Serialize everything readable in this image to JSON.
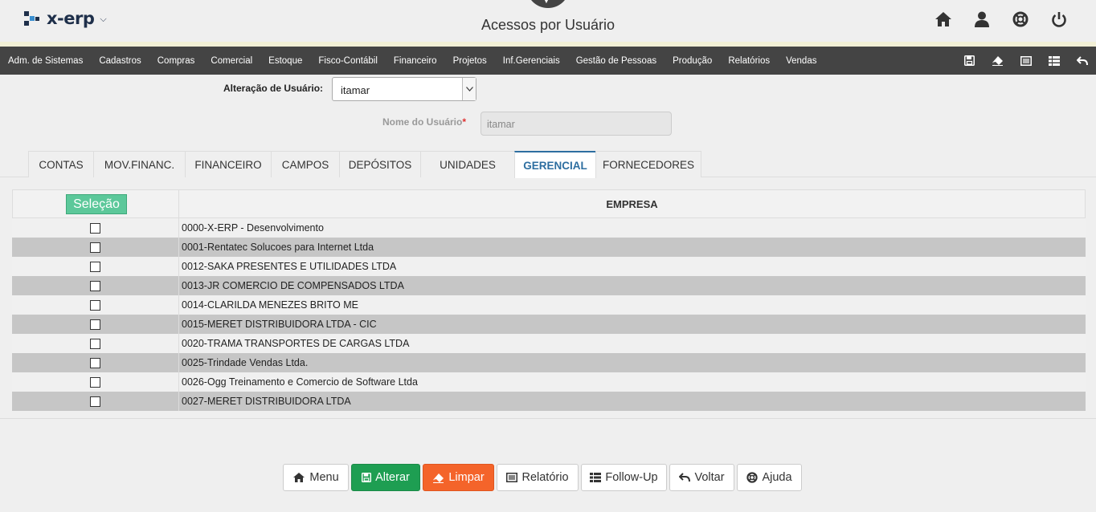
{
  "app": {
    "logo_text": "x-erp",
    "title": "Acessos por Usuário"
  },
  "header_icons": [
    "home-icon",
    "user-icon",
    "lifebuoy-icon",
    "power-icon"
  ],
  "menu": {
    "items": [
      "Adm. de Sistemas",
      "Cadastros",
      "Compras",
      "Comercial",
      "Estoque",
      "Fisco-Contábil",
      "Financeiro",
      "Projetos",
      "Inf.Gerenciais",
      "Gestão de Pessoas",
      "Produção",
      "Relatórios",
      "Vendas"
    ],
    "tools": [
      "save-icon",
      "eraser-icon",
      "list-icon",
      "table-icon",
      "undo-icon"
    ]
  },
  "form": {
    "user_label": "Alteração de Usuário:",
    "user_value": "itamar",
    "name_label": "Nome do Usuário",
    "name_required": "*",
    "name_value": "itamar"
  },
  "tabs": [
    {
      "label": "CONTAS",
      "active": false
    },
    {
      "label": "MOV.FINANC.",
      "active": false
    },
    {
      "label": "FINANCEIRO",
      "active": false
    },
    {
      "label": "CAMPOS",
      "active": false
    },
    {
      "label": "DEPÓSITOS",
      "active": false
    },
    {
      "label": "UNIDADES",
      "active": false
    },
    {
      "label": "GERENCIAL",
      "active": true
    },
    {
      "label": "FORNECEDORES",
      "active": false
    }
  ],
  "grid": {
    "select_label": "Seleção",
    "column_header": "EMPRESA",
    "rows": [
      "0000-X-ERP - Desenvolvimento",
      "0001-Rentatec Solucoes para Internet Ltda",
      "0012-SAKA PRESENTES E UTILIDADES LTDA",
      "0013-JR COMERCIO DE COMPENSADOS LTDA",
      "0014-CLARILDA MENEZES BRITO ME",
      "0015-MERET DISTRIBUIDORA LTDA - CIC",
      "0020-TRAMA TRANSPORTES DE CARGAS LTDA",
      "0025-Trindade Vendas Ltda.",
      "0026-Ogg Treinamento e Comercio de Software Ltda",
      "0027-MERET DISTRIBUIDORA LTDA"
    ]
  },
  "actions": {
    "menu": "Menu",
    "alterar": "Alterar",
    "limpar": "Limpar",
    "relatorio": "Relatório",
    "followup": "Follow-Up",
    "voltar": "Voltar",
    "ajuda": "Ajuda"
  },
  "colors": {
    "accent_green": "#1e9e52",
    "accent_orange": "#f4642a",
    "menubar": "#444444",
    "tab_active": "#2d6ea0",
    "select_button": "#5cc89a"
  }
}
